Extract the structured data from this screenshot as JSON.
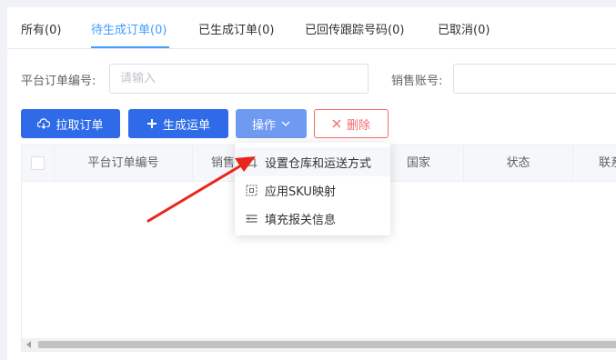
{
  "tabs": [
    {
      "label": "所有(0)"
    },
    {
      "label": "待生成订单(0)"
    },
    {
      "label": "已生成订单(0)"
    },
    {
      "label": "已回传跟踪号码(0)"
    },
    {
      "label": "已取消(0)"
    }
  ],
  "active_tab": 1,
  "filters": {
    "order_no_label": "平台订单编号:",
    "order_no_placeholder": "请输入",
    "order_no_value": "",
    "sales_account_label": "销售账号:",
    "sales_account_value": ""
  },
  "toolbar": {
    "pull_orders": "拉取订单",
    "create_waybill": "生成运单",
    "operation": "操作",
    "delete": "删除"
  },
  "table": {
    "columns": [
      "平台订单编号",
      "销售",
      "国家",
      "状态",
      "联系"
    ]
  },
  "menu": {
    "items": [
      {
        "label": "设置仓库和运送方式",
        "icon": "crop-icon"
      },
      {
        "label": "应用SKU映射",
        "icon": "mapping-icon"
      },
      {
        "label": "填充报关信息",
        "icon": "list-icon"
      }
    ]
  },
  "colors": {
    "accent": "#409eff",
    "primary_button": "#2f6be8",
    "operation_button": "#6f9af1",
    "danger": "#f56c6c",
    "annotation_arrow": "#e8261e"
  }
}
